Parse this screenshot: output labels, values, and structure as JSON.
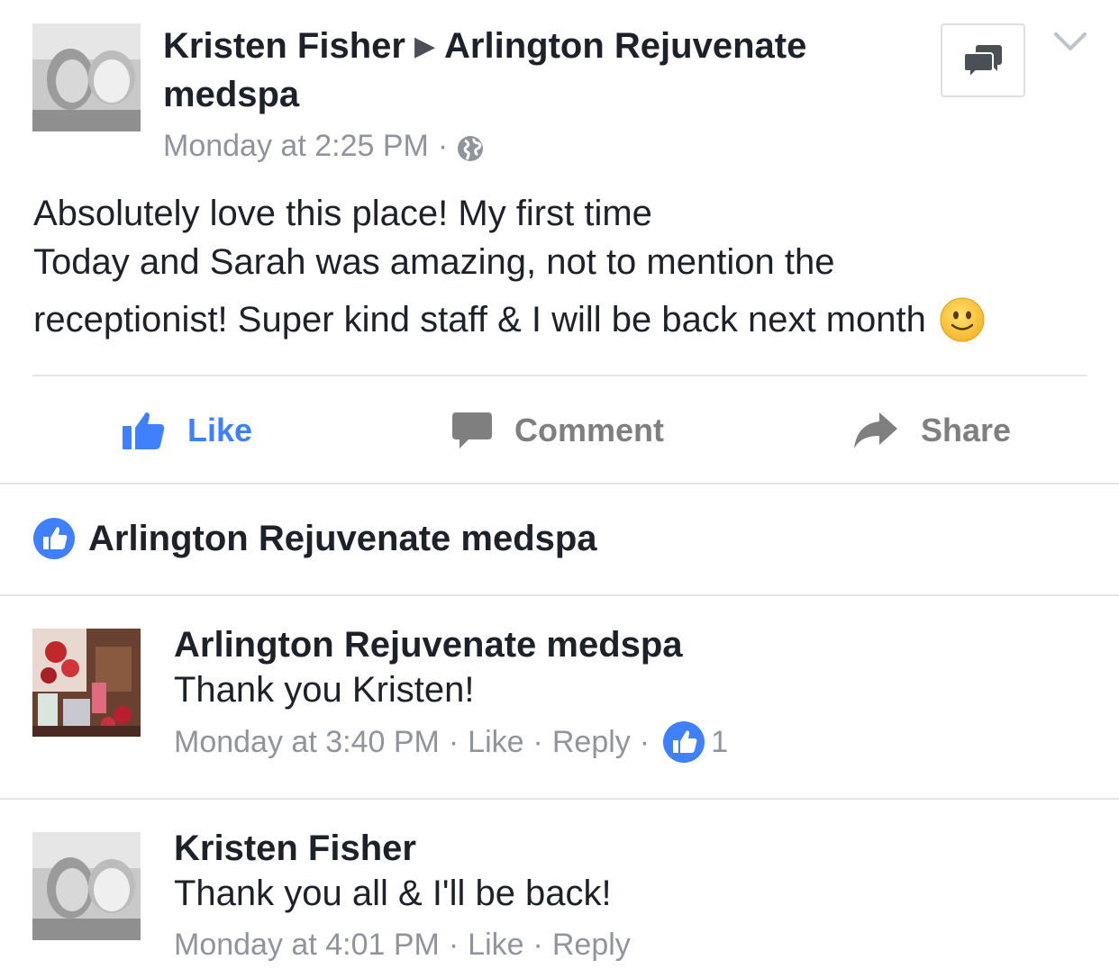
{
  "post": {
    "author": "Kristen Fisher",
    "target": "Arlington Rejuvenate medspa",
    "timestamp": "Monday at 2:25 PM",
    "privacy_icon": "globe-icon",
    "text_lines": [
      "Absolutely love this place! My first time",
      "Today and Sarah was amazing, not to mention the",
      "receptionist! Super kind staff & I will be back next month"
    ],
    "emoji": "smiley-face"
  },
  "actions": {
    "like": "Like",
    "comment": "Comment",
    "share": "Share"
  },
  "likes": {
    "name": "Arlington Rejuvenate medspa"
  },
  "comments": [
    {
      "author": "Arlington Rejuvenate medspa",
      "text": "Thank you Kristen!",
      "time": "Monday at 3:40 PM",
      "like": "Like",
      "reply": "Reply",
      "reaction_count": "1"
    },
    {
      "author": "Kristen Fisher",
      "text": "Thank you all & I'll be back!",
      "time": "Monday at 4:01 PM",
      "like": "Like",
      "reply": "Reply"
    }
  ],
  "colors": {
    "accent": "#4080ff",
    "meta_text": "#90949c",
    "divider": "#e5e6e9"
  }
}
